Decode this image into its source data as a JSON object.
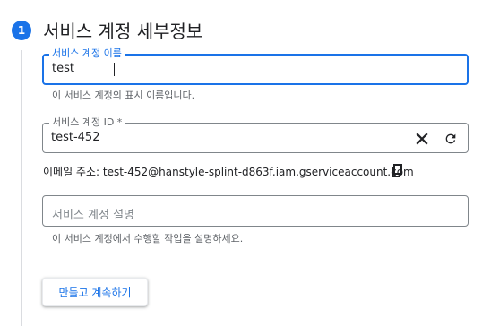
{
  "step": {
    "number": "1",
    "title": "서비스 계정 세부정보"
  },
  "name_field": {
    "label": "서비스 계정 이름",
    "value": "test",
    "hint": "이 서비스 계정의 표시 이름입니다."
  },
  "id_field": {
    "label": "서비스 계정 ID *",
    "value": "test-452",
    "clear_icon": "close-icon",
    "refresh_icon": "refresh-icon"
  },
  "email": {
    "label": "이메일 주소:",
    "address": "test-452@hanstyle-splint-d863f.iam.gserviceaccount.com",
    "copy_icon": "copy-icon"
  },
  "description_field": {
    "placeholder": "서비스 계정 설명",
    "hint": "이 서비스 계정에서 수행할 작업을 설명하세요."
  },
  "create_button": {
    "label": "만들고 계속하기"
  },
  "colors": {
    "accent": "#1a73e8",
    "border": "#80868b",
    "hint_text": "#5f6368"
  }
}
